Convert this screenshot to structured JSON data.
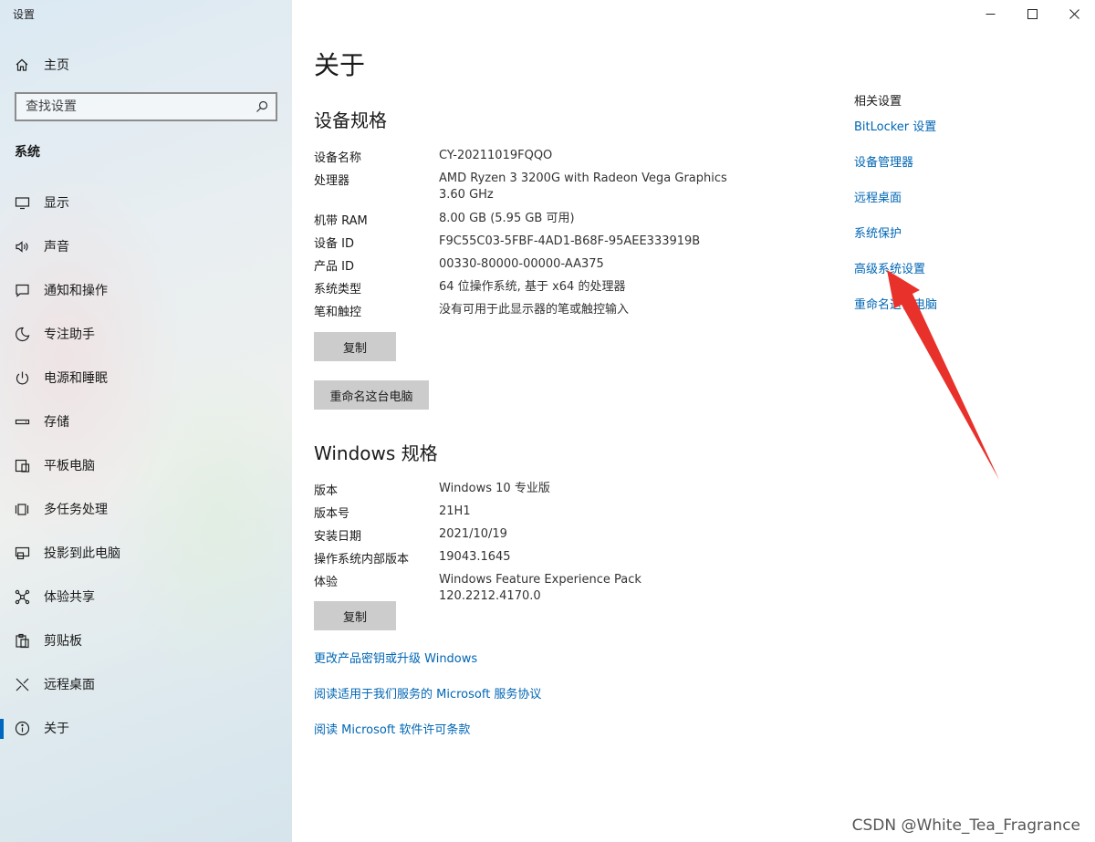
{
  "window": {
    "title": "设置",
    "controls": {
      "minimize": "minimize-icon",
      "maximize": "maximize-icon",
      "close": "close-icon"
    }
  },
  "sidebar": {
    "home_label": "主页",
    "search_placeholder": "查找设置",
    "section_title": "系统",
    "items": [
      {
        "label": "显示",
        "icon": "display-icon"
      },
      {
        "label": "声音",
        "icon": "sound-icon"
      },
      {
        "label": "通知和操作",
        "icon": "notification-icon"
      },
      {
        "label": "专注助手",
        "icon": "focus-assist-icon"
      },
      {
        "label": "电源和睡眠",
        "icon": "power-icon"
      },
      {
        "label": "存储",
        "icon": "storage-icon"
      },
      {
        "label": "平板电脑",
        "icon": "tablet-icon"
      },
      {
        "label": "多任务处理",
        "icon": "multitasking-icon"
      },
      {
        "label": "投影到此电脑",
        "icon": "projecting-icon"
      },
      {
        "label": "体验共享",
        "icon": "shared-experiences-icon"
      },
      {
        "label": "剪贴板",
        "icon": "clipboard-icon"
      },
      {
        "label": "远程桌面",
        "icon": "remote-desktop-icon"
      },
      {
        "label": "关于",
        "icon": "info-icon",
        "active": true
      }
    ]
  },
  "main": {
    "title": "关于",
    "device_specs": {
      "heading": "设备规格",
      "rows": [
        {
          "key": "设备名称",
          "value": "CY-20211019FQQO"
        },
        {
          "key": "处理器",
          "value": "AMD Ryzen 3 3200G with Radeon Vega Graphics",
          "value2": "3.60 GHz"
        },
        {
          "key": "机带 RAM",
          "value": "8.00 GB (5.95 GB 可用)"
        },
        {
          "key": "设备 ID",
          "value": "F9C55C03-5FBF-4AD1-B68F-95AEE333919B"
        },
        {
          "key": "产品 ID",
          "value": "00330-80000-00000-AA375"
        },
        {
          "key": "系统类型",
          "value": "64 位操作系统, 基于 x64 的处理器"
        },
        {
          "key": "笔和触控",
          "value": "没有可用于此显示器的笔或触控输入"
        }
      ],
      "copy_button": "复制",
      "rename_button": "重命名这台电脑"
    },
    "windows_specs": {
      "heading": "Windows 规格",
      "rows": [
        {
          "key": "版本",
          "value": "Windows 10 专业版"
        },
        {
          "key": "版本号",
          "value": "21H1"
        },
        {
          "key": "安装日期",
          "value": "2021/10/19"
        },
        {
          "key": "操作系统内部版本",
          "value": "19043.1645"
        },
        {
          "key": "体验",
          "value": "Windows Feature Experience Pack 120.2212.4170.0"
        }
      ],
      "copy_button": "复制"
    },
    "links": [
      "更改产品密钥或升级 Windows",
      "阅读适用于我们服务的 Microsoft 服务协议",
      "阅读 Microsoft 软件许可条款"
    ]
  },
  "related": {
    "title": "相关设置",
    "links": [
      "BitLocker 设置",
      "设备管理器",
      "远程桌面",
      "系统保护",
      "高级系统设置",
      "重命名这台电脑"
    ]
  },
  "annotation": {
    "arrow_color": "#e8312a"
  },
  "watermark": "CSDN @White_Tea_Fragrance"
}
